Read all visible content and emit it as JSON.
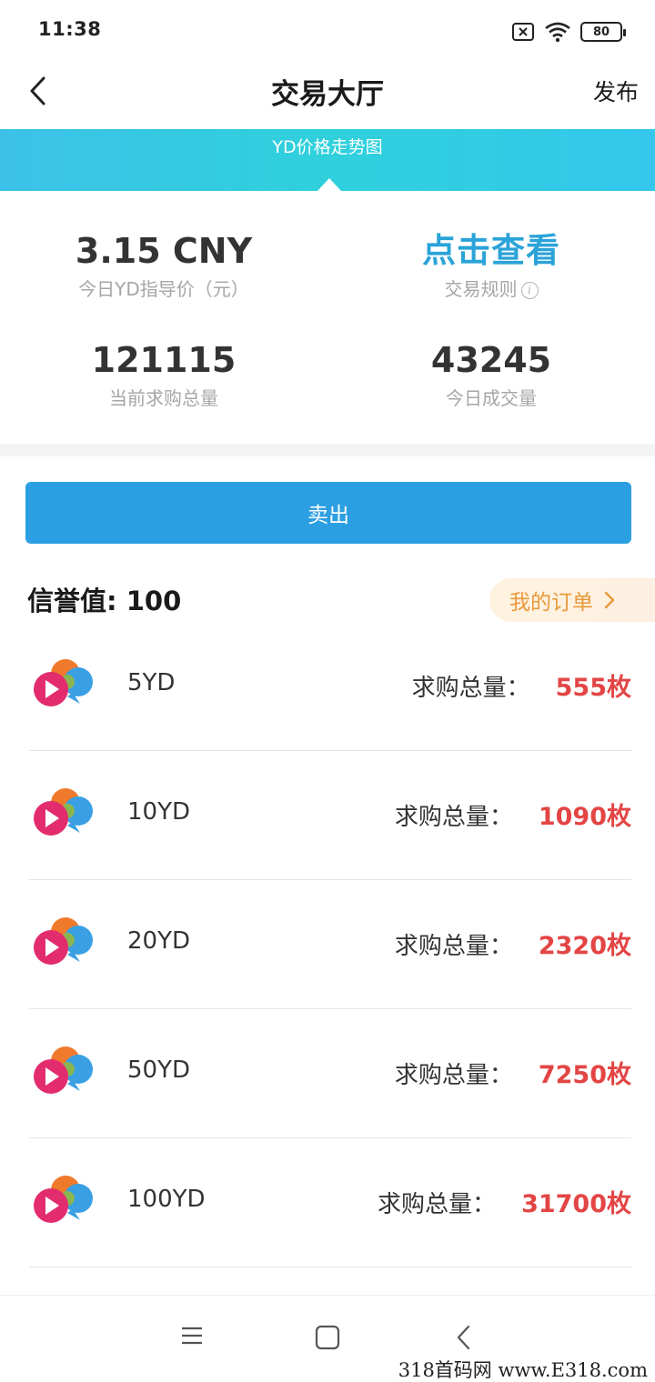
{
  "status_bar": {
    "time": "11:38",
    "battery": "80"
  },
  "nav": {
    "title": "交易大厅",
    "publish_label": "发布"
  },
  "banner": {
    "label": "YD价格走势图"
  },
  "stats": {
    "guide_price_value": "3.15 CNY",
    "guide_price_label": "今日YD指导价（元）",
    "rules_value": "点击查看",
    "rules_label": "交易规则",
    "demand_total_value": "121115",
    "demand_total_label": "当前求购总量",
    "volume_value": "43245",
    "volume_label": "今日成交量"
  },
  "sell_button_label": "卖出",
  "credit": {
    "label": "信誉值:",
    "value": "100"
  },
  "my_orders_label": "我的订单",
  "packages": [
    {
      "name": "5YD",
      "demand_label": "求购总量：",
      "demand_value": "555枚"
    },
    {
      "name": "10YD",
      "demand_label": "求购总量：",
      "demand_value": "1090枚"
    },
    {
      "name": "20YD",
      "demand_label": "求购总量：",
      "demand_value": "2320枚"
    },
    {
      "name": "50YD",
      "demand_label": "求购总量：",
      "demand_value": "7250枚"
    },
    {
      "name": "100YD",
      "demand_label": "求购总量：",
      "demand_value": "31700枚"
    }
  ],
  "watermark": "318首码网 www.E318.com",
  "icons": {
    "back": "chevron-left-icon",
    "info": "info-icon",
    "orders_chevron": "chevron-right-icon",
    "logo": "yd-logo-icon",
    "menu": "menu-icon",
    "home": "home-square-icon",
    "nav_back": "nav-back-icon"
  },
  "colors": {
    "accent_blue": "#2c9fe3",
    "rules_blue": "#2aa3d8",
    "banner_cyan": "#2fd0dc",
    "demand_red": "#e34545",
    "orders_orange": "#e89a3b"
  }
}
